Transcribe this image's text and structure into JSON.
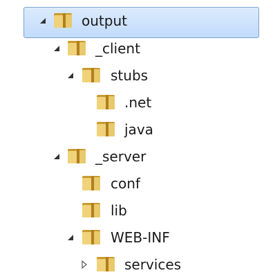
{
  "tree": {
    "items": [
      {
        "label": "output",
        "expanded": true,
        "selected": true,
        "toggle_icon": "expanded-arrow-icon",
        "icon": "folder-icon"
      },
      {
        "label": "_client",
        "expanded": true,
        "toggle_icon": "expanded-arrow-icon",
        "icon": "folder-icon"
      },
      {
        "label": "stubs",
        "expanded": true,
        "toggle_icon": "expanded-arrow-icon",
        "icon": "folder-icon"
      },
      {
        "label": ".net",
        "icon": "folder-icon"
      },
      {
        "label": "java",
        "icon": "folder-icon"
      },
      {
        "label": "_server",
        "expanded": true,
        "toggle_icon": "expanded-arrow-icon",
        "icon": "folder-icon"
      },
      {
        "label": "conf",
        "icon": "folder-icon"
      },
      {
        "label": "lib",
        "icon": "folder-icon"
      },
      {
        "label": "WEB-INF",
        "expanded": true,
        "toggle_icon": "expanded-arrow-icon",
        "icon": "folder-icon"
      },
      {
        "label": "services",
        "expanded": false,
        "toggle_icon": "collapsed-arrow-icon",
        "icon": "folder-icon"
      }
    ]
  },
  "colors": {
    "selection_fill": "#cfe3fc",
    "selection_border": "#7da2ce",
    "folder_body": "#e8c96b",
    "folder_shade": "#c99a2e",
    "arrow": "#333333",
    "arrow_open": "#575757"
  }
}
